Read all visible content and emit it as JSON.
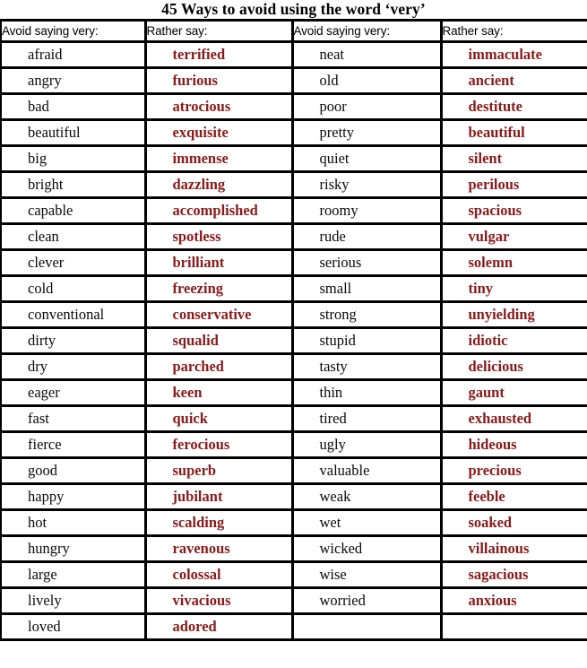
{
  "title": "45 Ways to avoid using the word ‘very’",
  "colors": {
    "avoid_text": "#0a0a0a",
    "rather_text": "#8B1A1A",
    "border": "#000000",
    "background": "#ffffff"
  },
  "table": {
    "headers": [
      "Avoid saying very:",
      "Rather say:",
      "Avoid saying very:",
      "Rather say:"
    ],
    "rows": [
      [
        "afraid",
        "terrified",
        "neat",
        "immaculate"
      ],
      [
        "angry",
        "furious",
        "old",
        "ancient"
      ],
      [
        "bad",
        "atrocious",
        "poor",
        "destitute"
      ],
      [
        "beautiful",
        "exquisite",
        "pretty",
        "beautiful"
      ],
      [
        "big",
        "immense",
        "quiet",
        "silent"
      ],
      [
        "bright",
        "dazzling",
        "risky",
        "perilous"
      ],
      [
        "capable",
        "accomplished",
        "roomy",
        "spacious"
      ],
      [
        "clean",
        "spotless",
        "rude",
        "vulgar"
      ],
      [
        "clever",
        "brilliant",
        "serious",
        "solemn"
      ],
      [
        "cold",
        "freezing",
        "small",
        "tiny"
      ],
      [
        "conventional",
        "conservative",
        "strong",
        "unyielding"
      ],
      [
        "dirty",
        "squalid",
        "stupid",
        "idiotic"
      ],
      [
        "dry",
        "parched",
        "tasty",
        "delicious"
      ],
      [
        "eager",
        "keen",
        "thin",
        "gaunt"
      ],
      [
        "fast",
        "quick",
        "tired",
        "exhausted"
      ],
      [
        "fierce",
        "ferocious",
        "ugly",
        "hideous"
      ],
      [
        "good",
        "superb",
        "valuable",
        "precious"
      ],
      [
        "happy",
        "jubilant",
        "weak",
        "feeble"
      ],
      [
        "hot",
        "scalding",
        "wet",
        "soaked"
      ],
      [
        "hungry",
        "ravenous",
        "wicked",
        "villainous"
      ],
      [
        "large",
        "colossal",
        "wise",
        "sagacious"
      ],
      [
        "lively",
        "vivacious",
        "worried",
        "anxious"
      ],
      [
        "loved",
        "adored",
        "",
        ""
      ]
    ]
  }
}
